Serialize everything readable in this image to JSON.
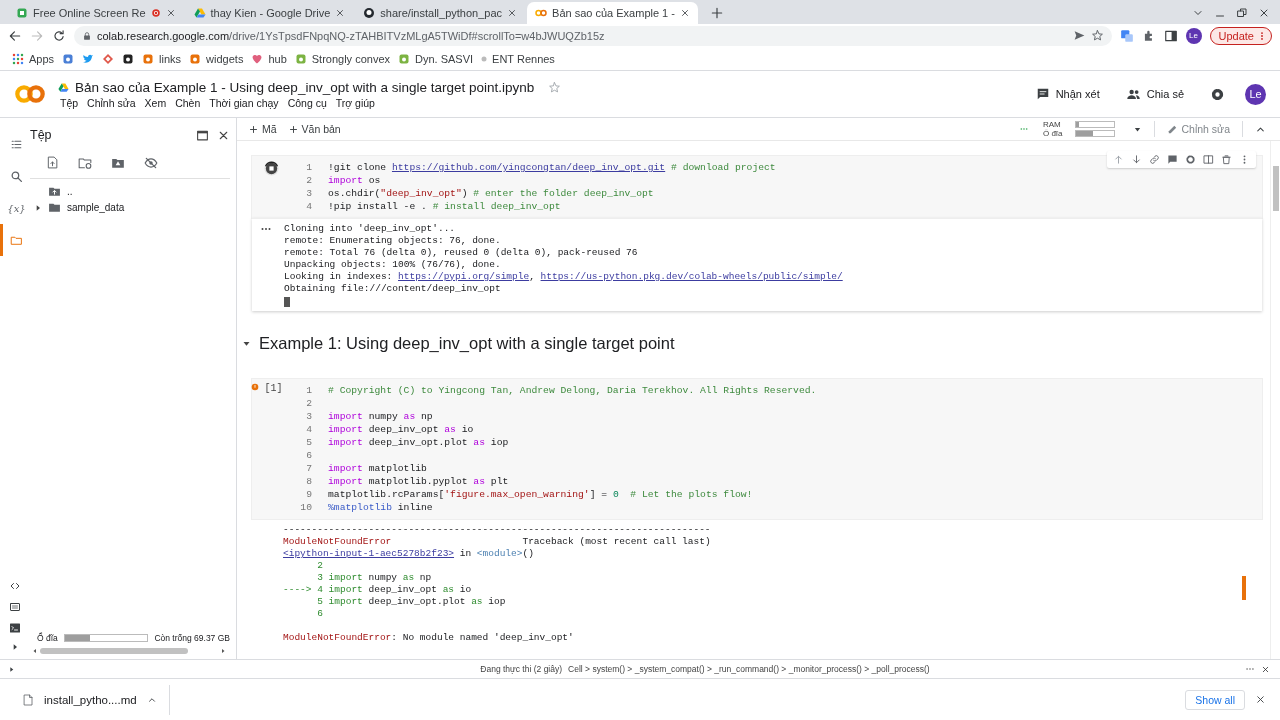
{
  "browser": {
    "tabs": [
      {
        "title": "Free Online Screen Re",
        "selected": false,
        "recording": true
      },
      {
        "title": "thay Kien - Google Drive",
        "selected": false
      },
      {
        "title": "share/install_python_pac",
        "selected": false
      },
      {
        "title": "Bản sao của Example 1 -",
        "selected": true
      }
    ],
    "address": {
      "host": "colab.research.google.com",
      "path": "/drive/1YsTpsdFNpqNQ-zTAHBITVzMLgA5TWiDf#scrollTo=w4bJWUQZb15z"
    },
    "profile": "Le",
    "update_button": "Update",
    "bookmarks": [
      {
        "kind": "grid",
        "label": "Apps"
      },
      {
        "kind": "tile",
        "color": "#4a7fd6"
      },
      {
        "kind": "bird",
        "color": "#1d9bf0"
      },
      {
        "kind": "diamond",
        "color": "#e0584b"
      },
      {
        "kind": "tile",
        "color": "#222222"
      },
      {
        "kind": "tile",
        "label": "links",
        "color": "#e8710a"
      },
      {
        "kind": "tile",
        "label": "widgets",
        "color": "#e8710a"
      },
      {
        "kind": "heart",
        "label": "hub",
        "color": "#e0607e"
      },
      {
        "kind": "tile",
        "label": "Strongly convex",
        "color": "#7cb342"
      },
      {
        "kind": "tile",
        "label": "Dyn. SASVI",
        "color": "#7cb342"
      },
      {
        "kind": "dot",
        "label": "ENT Rennes",
        "color": "#bbbbbb"
      }
    ]
  },
  "notebook": {
    "title": "Bản sao của Example 1 - Using deep_inv_opt with a single target point.ipynb",
    "menu": [
      "Tệp",
      "Chỉnh sửa",
      "Xem",
      "Chèn",
      "Thời gian chạy",
      "Công cụ",
      "Trợ giúp"
    ],
    "comment_button": "Nhận xét",
    "share_button": "Chia sẻ",
    "avatar": "Le",
    "toolbar": {
      "add_code": "Mã",
      "add_text": "Văn bản",
      "ram": {
        "label": "RAM",
        "level": 0.08
      },
      "disk": {
        "label": "Ổ đĩa",
        "level": 0.45
      },
      "edit_button": "Chỉnh sửa"
    }
  },
  "sidebar": {
    "title": "Tệp",
    "rail": [
      {
        "selected": false
      },
      {
        "selected": false
      },
      {
        "symbol": "{x}",
        "selected": false
      },
      {
        "selected": true
      }
    ],
    "files": [
      {
        "kind": "parent",
        "name": ".."
      },
      {
        "kind": "folder",
        "name": "sample_data",
        "expanded": false
      }
    ],
    "disk": {
      "label": "Ổ đĩa",
      "level": 0.3,
      "free": "Còn trống 69.37 GB"
    }
  },
  "cells": [
    {
      "kind": "code",
      "running": true,
      "error": false,
      "lines": [
        {
          "n": "1",
          "parts": [
            {
              "kind": "plain",
              "text": "!git clone "
            },
            {
              "kind": "link",
              "text": "https://github.com/yingcongtan/deep_inv_opt.git"
            },
            {
              "kind": "comment",
              "text": " # download project"
            }
          ]
        },
        {
          "n": "2",
          "parts": [
            {
              "kind": "kw",
              "text": "import"
            },
            {
              "kind": "plain",
              "text": " os"
            }
          ]
        },
        {
          "n": "3",
          "parts": [
            {
              "kind": "plain",
              "text": "os.chdir("
            },
            {
              "kind": "str",
              "text": "\"deep_inv_opt\""
            },
            {
              "kind": "plain",
              "text": ") "
            },
            {
              "kind": "comment",
              "text": "# enter the folder deep_inv_opt"
            }
          ]
        },
        {
          "n": "4",
          "parts": [
            {
              "kind": "plain",
              "text": "!pip install -e . "
            },
            {
              "kind": "comment",
              "text": "# install deep_inv_opt"
            }
          ]
        }
      ],
      "output": [
        {
          "parts": [
            {
              "kind": "plain",
              "text": "Cloning into 'deep_inv_opt'..."
            }
          ]
        },
        {
          "parts": [
            {
              "kind": "plain",
              "text": "remote: Enumerating objects: 76, done."
            }
          ]
        },
        {
          "parts": [
            {
              "kind": "plain",
              "text": "remote: Total 76 (delta 0), reused 0 (delta 0), pack-reused 76"
            }
          ]
        },
        {
          "parts": [
            {
              "kind": "plain",
              "text": "Unpacking objects: 100% (76/76), done."
            }
          ]
        },
        {
          "parts": [
            {
              "kind": "plain",
              "text": "Looking in indexes: "
            },
            {
              "kind": "link",
              "text": "https://pypi.org/simple"
            },
            {
              "kind": "plain",
              "text": ", "
            },
            {
              "kind": "link",
              "text": "https://us-python.pkg.dev/colab-wheels/public/simple/"
            }
          ]
        },
        {
          "parts": [
            {
              "kind": "plain",
              "text": "Obtaining file:///content/deep_inv_opt"
            }
          ]
        }
      ],
      "input_cursor": true
    },
    {
      "kind": "heading",
      "text": "Example 1: Using deep_inv_opt with a single target point",
      "expanded": true
    },
    {
      "kind": "code",
      "running": false,
      "error": true,
      "count": "[1]",
      "lines": [
        {
          "n": "1",
          "parts": [
            {
              "kind": "comment",
              "text": "# Copyright (C) to Yingcong Tan, Andrew Delong, Daria Terekhov. All Rights Reserved."
            }
          ]
        },
        {
          "n": "2"
        },
        {
          "n": "3",
          "parts": [
            {
              "kind": "kw",
              "text": "import"
            },
            {
              "kind": "plain",
              "text": " numpy "
            },
            {
              "kind": "kw",
              "text": "as"
            },
            {
              "kind": "plain",
              "text": " np"
            }
          ]
        },
        {
          "n": "4",
          "parts": [
            {
              "kind": "kw",
              "text": "import"
            },
            {
              "kind": "plain",
              "text": " deep_inv_opt "
            },
            {
              "kind": "kw",
              "text": "as"
            },
            {
              "kind": "plain",
              "text": " io"
            }
          ]
        },
        {
          "n": "5",
          "parts": [
            {
              "kind": "kw",
              "text": "import"
            },
            {
              "kind": "plain",
              "text": " deep_inv_opt.plot "
            },
            {
              "kind": "kw",
              "text": "as"
            },
            {
              "kind": "plain",
              "text": " iop"
            }
          ]
        },
        {
          "n": "6"
        },
        {
          "n": "7",
          "parts": [
            {
              "kind": "kw",
              "text": "import"
            },
            {
              "kind": "plain",
              "text": " matplotlib"
            }
          ]
        },
        {
          "n": "8",
          "parts": [
            {
              "kind": "kw",
              "text": "import"
            },
            {
              "kind": "plain",
              "text": " matplotlib.pyplot "
            },
            {
              "kind": "kw",
              "text": "as"
            },
            {
              "kind": "plain",
              "text": " plt"
            }
          ]
        },
        {
          "n": "9",
          "parts": [
            {
              "kind": "plain",
              "text": "matplotlib.rcParams["
            },
            {
              "kind": "str",
              "text": "'figure.max_open_warning'"
            },
            {
              "kind": "plain",
              "text": "] = "
            },
            {
              "kind": "num",
              "text": "0"
            },
            {
              "kind": "comment",
              "text": "  # Let the plots flow!"
            }
          ]
        },
        {
          "n": "10",
          "parts": [
            {
              "kind": "magic",
              "text": "%matplotlib"
            },
            {
              "kind": "plain",
              "text": " inline"
            }
          ]
        }
      ],
      "output": [
        {
          "parts": [
            {
              "kind": "plain",
              "text": "---------------------------------------------------------------------------"
            }
          ]
        },
        {
          "parts": [
            {
              "kind": "err",
              "text": "ModuleNotFoundError"
            },
            {
              "kind": "plain",
              "text": "                       Traceback (most recent call last)"
            }
          ]
        },
        {
          "parts": [
            {
              "kind": "link",
              "text": "<ipython-input-1-aec5278b2f23>"
            },
            {
              "kind": "plain",
              "text": " in "
            },
            {
              "kind": "module",
              "text": "<module>"
            },
            {
              "kind": "plain",
              "text": "()"
            }
          ]
        },
        {
          "parts": [
            {
              "kind": "green",
              "text": "      2"
            }
          ]
        },
        {
          "parts": [
            {
              "kind": "green",
              "text": "      3 import"
            },
            {
              "kind": "plain",
              "text": " numpy "
            },
            {
              "kind": "green",
              "text": "as"
            },
            {
              "kind": "plain",
              "text": " np"
            }
          ]
        },
        {
          "parts": [
            {
              "kind": "green",
              "text": "----> 4 import"
            },
            {
              "kind": "plain",
              "text": " deep_inv_opt "
            },
            {
              "kind": "green",
              "text": "as"
            },
            {
              "kind": "plain",
              "text": " io"
            }
          ]
        },
        {
          "parts": [
            {
              "kind": "green",
              "text": "      5 import"
            },
            {
              "kind": "plain",
              "text": " deep_inv_opt.plot "
            },
            {
              "kind": "green",
              "text": "as"
            },
            {
              "kind": "plain",
              "text": " iop"
            }
          ]
        },
        {
          "parts": [
            {
              "kind": "green",
              "text": "      6"
            }
          ]
        },
        {
          "gap_before": true,
          "parts": [
            {
              "kind": "err",
              "text": "ModuleNotFoundError"
            },
            {
              "kind": "plain",
              "text": ": No module named 'deep_inv_opt'"
            }
          ]
        }
      ]
    }
  ],
  "status": {
    "state": "Đang thực thi (2 giây)",
    "trace": "Cell > system() > _system_compat() > _run_command() > _monitor_process() > _poll_process()"
  },
  "downloads": {
    "file": "install_pytho....md",
    "show_all": "Show all"
  }
}
